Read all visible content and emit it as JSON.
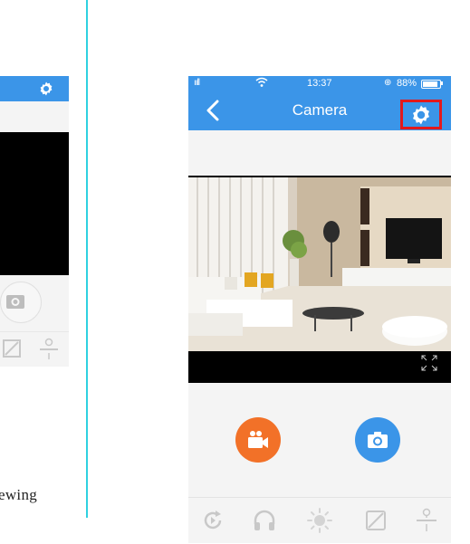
{
  "left_panel": {
    "caption_fragment": "ewing"
  },
  "status_bar": {
    "signal": "ııll",
    "time": "13:37",
    "lock_glyph": "⊕",
    "battery_text": "88%",
    "battery_level": 0.88
  },
  "nav": {
    "title": "Camera",
    "back_icon": "chevron-left-icon",
    "settings_icon": "gear-icon",
    "highlight_color": "#e3191c"
  },
  "video": {
    "fullscreen_icon": "expand-icon"
  },
  "controls": {
    "record_icon": "video-camera-icon",
    "record_color": "#f27128",
    "snapshot_icon": "camera-icon",
    "snapshot_color": "#3b95e8"
  },
  "toolbar": {
    "items": [
      "rotate-icon",
      "headphones-icon",
      "brightness-icon",
      "contrast-icon",
      "slider-icon"
    ]
  },
  "colors": {
    "primary": "#3b95e8",
    "divider": "#2fd1e0",
    "background": "#f4f4f4"
  }
}
